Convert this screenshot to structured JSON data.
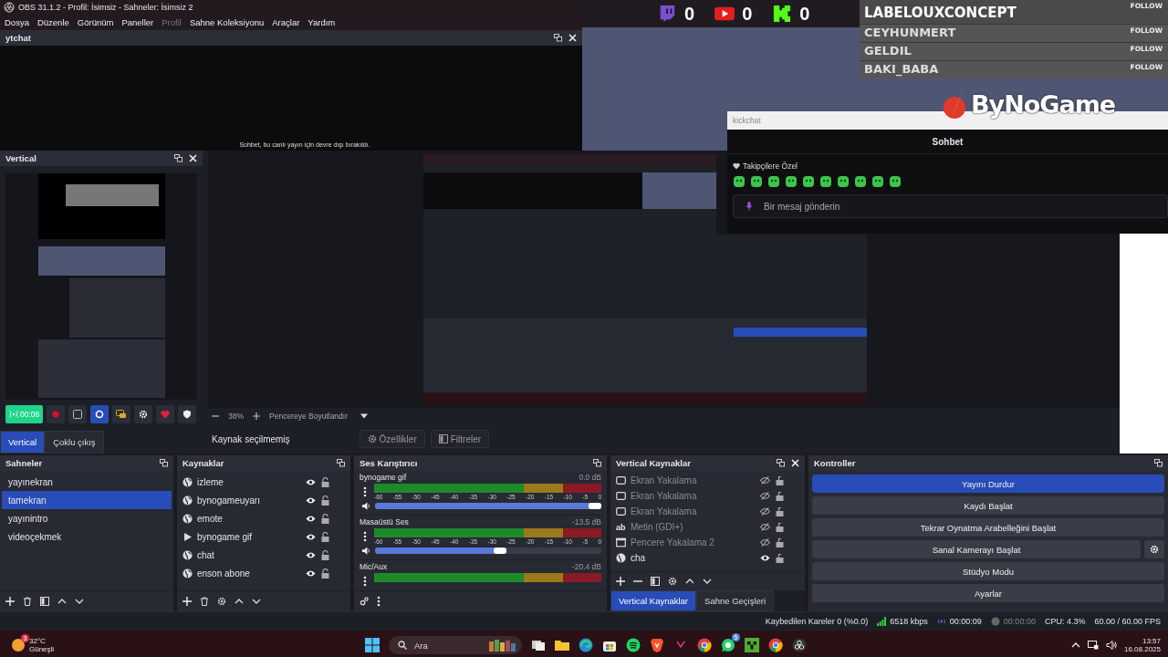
{
  "window": {
    "title": "OBS 31.1.2 - Profil: İsimsiz - Sahneler: İsimsiz 2"
  },
  "menu": [
    {
      "label": "Dosya",
      "disabled": false
    },
    {
      "label": "Düzenle",
      "disabled": false
    },
    {
      "label": "Görünüm",
      "disabled": false
    },
    {
      "label": "Paneller",
      "disabled": false
    },
    {
      "label": "Profil",
      "disabled": true
    },
    {
      "label": "Sahne Koleksiyonu",
      "disabled": false
    },
    {
      "label": "Araçlar",
      "disabled": false
    },
    {
      "label": "Yardım",
      "disabled": false
    }
  ],
  "ytchat": {
    "title": "ytchat",
    "message": "Sohbet, bu canlı yayın için devre dışı bırakıldı."
  },
  "overlay": {
    "counters": [
      {
        "kind": "twitch",
        "value": "0"
      },
      {
        "kind": "youtube",
        "value": "0"
      },
      {
        "kind": "kick",
        "value": "0"
      }
    ],
    "followers": [
      {
        "name": "LABELOUXCONCEPT",
        "action": "FOLLOW"
      },
      {
        "name": "CEYHUNMERT",
        "action": "FOLLOW"
      },
      {
        "name": "GELDIL",
        "action": "FOLLOW"
      },
      {
        "name": "BAKI_BABA",
        "action": "FOLLOW"
      }
    ],
    "logo": "ByNoGame"
  },
  "kickchat": {
    "title": "kickchat",
    "header": "Sohbet",
    "badge": "Takipçilere Özel",
    "placeholder": "Bir mesaj gönderin"
  },
  "vertical": {
    "title": "Vertical",
    "timer": "00:06",
    "tabs": [
      {
        "label": "Vertical",
        "selected": true
      },
      {
        "label": "Çoklu çıkış",
        "selected": false
      }
    ]
  },
  "preview": {
    "zoom": "38%",
    "fit": "Pencereye Boyutlandır"
  },
  "source_bar": {
    "status": "Kaynak seçilmemiş",
    "buttons": [
      "Özellikler",
      "Filtreler"
    ]
  },
  "scenes": {
    "title": "Sahneler",
    "items": [
      {
        "label": "yayınekran",
        "selected": false
      },
      {
        "label": "tamekran",
        "selected": true
      },
      {
        "label": "yayınintro",
        "selected": false
      },
      {
        "label": "videoçekmek",
        "selected": false
      }
    ]
  },
  "sources": {
    "title": "Kaynaklar",
    "items": [
      {
        "label": "izleme",
        "kind": "browser"
      },
      {
        "label": "bynogameuyarı",
        "kind": "browser"
      },
      {
        "label": "emote",
        "kind": "browser"
      },
      {
        "label": "bynogame gif",
        "kind": "media"
      },
      {
        "label": "chat",
        "kind": "browser"
      },
      {
        "label": "enson abone",
        "kind": "browser"
      }
    ]
  },
  "mixer": {
    "title": "Ses Karıştırıcı",
    "channels": [
      {
        "name": "bynogame gif",
        "reading": "0.0 dB",
        "level": 1.0,
        "scale": [
          "-60",
          "-55",
          "-50",
          "-45",
          "-40",
          "-35",
          "-30",
          "-25",
          "-20",
          "-15",
          "-10",
          "-5",
          "0"
        ]
      },
      {
        "name": "Masaüstü Ses",
        "reading": "-13.5 dB",
        "level": 0.58,
        "scale": [
          "-60",
          "-55",
          "-50",
          "-45",
          "-40",
          "-35",
          "-30",
          "-25",
          "-20",
          "-15",
          "-10",
          "-5",
          "0"
        ]
      },
      {
        "name": "Mic/Aux",
        "reading": "-20.4 dB"
      }
    ]
  },
  "vertical_sources": {
    "title": "Vertical Kaynaklar",
    "items": [
      {
        "label": "Ekran Yakalama",
        "kind": "display",
        "visible": false
      },
      {
        "label": "Ekran Yakalama",
        "kind": "display",
        "visible": false
      },
      {
        "label": "Ekran Yakalama",
        "kind": "display",
        "visible": false
      },
      {
        "label": "Metin (GDI+)",
        "kind": "text",
        "glyph": "ab",
        "visible": false
      },
      {
        "label": "Pencere Yakalama 2",
        "kind": "window",
        "visible": false
      },
      {
        "label": "cha",
        "kind": "browser",
        "visible": true
      }
    ],
    "tabs": [
      {
        "label": "Vertical Kaynaklar",
        "selected": true
      },
      {
        "label": "Sahne Geçişleri",
        "selected": false
      }
    ]
  },
  "controls": {
    "title": "Kontroller",
    "buttons": [
      {
        "label": "Yayını Durdur",
        "active": true,
        "kind": "plain"
      },
      {
        "label": "Kaydı Başlat",
        "active": false,
        "kind": "plain"
      },
      {
        "label": "Tekrar Oynatma Arabelleğini Başlat",
        "active": false,
        "kind": "plain"
      },
      {
        "label": "Sanal Kamerayı Başlat",
        "active": false,
        "kind": "settings"
      },
      {
        "label": "Stüdyo Modu",
        "active": false,
        "kind": "plain"
      },
      {
        "label": "Ayarlar",
        "active": false,
        "kind": "plain"
      }
    ]
  },
  "status": {
    "dropped": "Kaybedilen Kareler 0 (%0.0)",
    "bitrate": "6518 kbps",
    "stream_time": "00:00:09",
    "rec_time": "00:00:00",
    "cpu": "CPU: 4.3%",
    "fps": "60.00 / 60.00 FPS"
  },
  "taskbar": {
    "temp": "32°C",
    "condition": "Güneşli",
    "weather_badge": "3",
    "search": "Ara",
    "whatsapp_badge": "5",
    "time": "13:57",
    "date": "16.08.2025"
  }
}
